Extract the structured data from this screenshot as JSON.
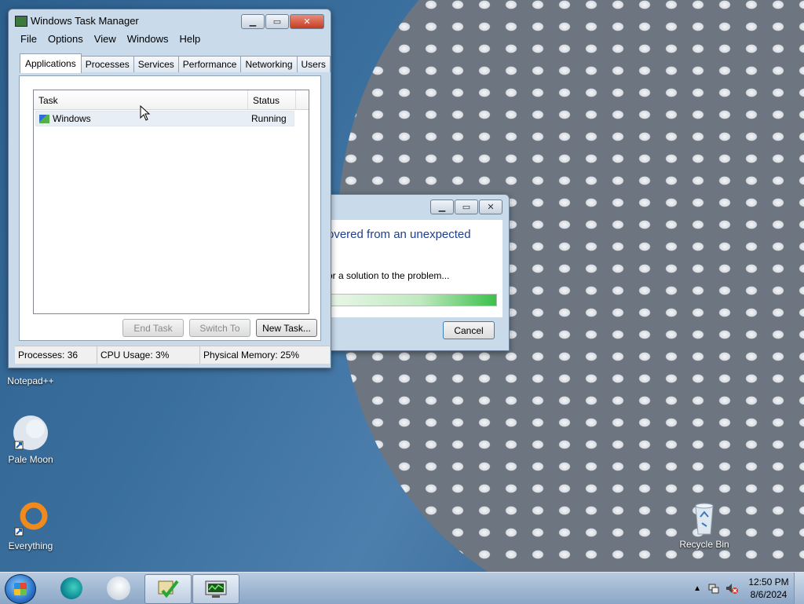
{
  "desktop": {
    "icons": [
      {
        "label": "Notepad++"
      },
      {
        "label": "Pale Moon"
      },
      {
        "label": "Everything"
      },
      {
        "label": "Recycle Bin"
      }
    ]
  },
  "task_manager": {
    "title": "Windows Task Manager",
    "menu": [
      "File",
      "Options",
      "View",
      "Windows",
      "Help"
    ],
    "tabs": [
      "Applications",
      "Processes",
      "Services",
      "Performance",
      "Networking",
      "Users"
    ],
    "active_tab": "Applications",
    "columns": {
      "task": "Task",
      "status": "Status"
    },
    "rows": [
      {
        "task": "Windows",
        "status": "Running"
      }
    ],
    "buttons": {
      "end_task": "End Task",
      "switch_to": "Switch To",
      "new_task": "New Task..."
    },
    "status": {
      "processes": "Processes: 36",
      "cpu": "CPU Usage: 3%",
      "memory": "Physical Memory: 25%"
    }
  },
  "error_dialog": {
    "heading": "overed from an unexpected",
    "message": "or a solution to the problem...",
    "progress": 1.0,
    "cancel_label": "Cancel"
  },
  "taskbar": {
    "time": "12:50 PM",
    "date": "8/6/2024"
  },
  "colors": {
    "accent": "#1f4f7c",
    "dialog_heading": "#1e3f8c",
    "progress_green": "#3cc04a"
  }
}
